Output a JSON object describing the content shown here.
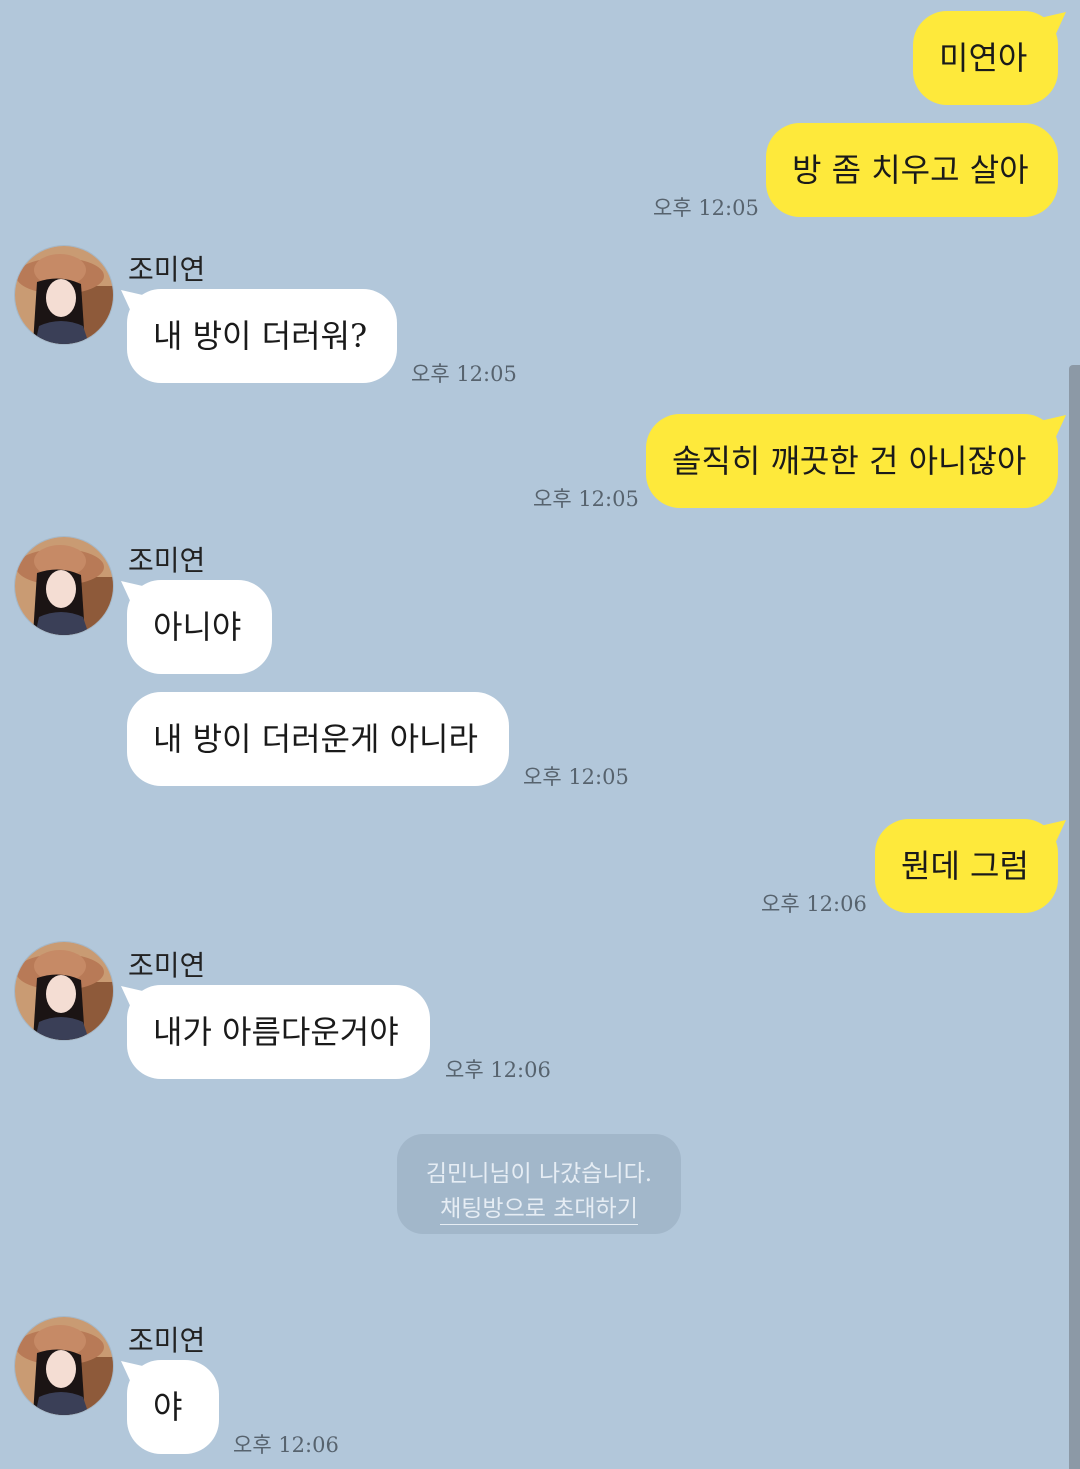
{
  "contact_name": "조미연",
  "messages": [
    {
      "text": "미연아"
    },
    {
      "text": "방 좀 치우고 살아",
      "time": "오후 12:05"
    },
    {
      "text": "내 방이 더러워?",
      "time": "오후 12:05"
    },
    {
      "text": "솔직히 깨끗한 건 아니잖아",
      "time": "오후 12:05"
    },
    {
      "text": "아니야"
    },
    {
      "text": "내 방이 더러운게 아니라",
      "time": "오후 12:05"
    },
    {
      "text": "뭔데 그럼",
      "time": "오후 12:06"
    },
    {
      "text": "내가 아름다운거야",
      "time": "오후 12:06"
    },
    {
      "text": "야",
      "time": "오후 12:06"
    }
  ],
  "system_notice": {
    "text": "김민니님이 나갔습니다.",
    "action": "채팅방으로 초대하기"
  },
  "colors": {
    "background": "#b2c7da",
    "my_bubble": "#fee93b",
    "their_bubble": "#ffffff"
  }
}
